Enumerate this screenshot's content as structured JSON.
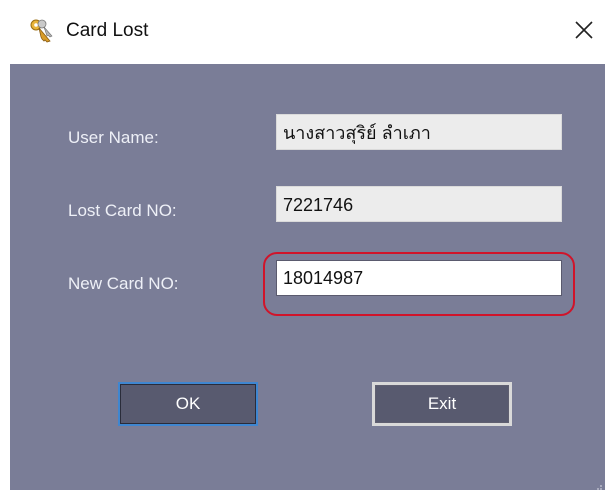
{
  "window": {
    "title": "Card Lost",
    "close_glyph": "✕",
    "icon": "keys-icon"
  },
  "form": {
    "user_name": {
      "label": "User Name:",
      "value": "นางสาวสุริย์ ลำเภา"
    },
    "lost_card": {
      "label": "Lost Card NO:",
      "value": "7221746"
    },
    "new_card": {
      "label": "New Card NO:",
      "value": "18014987"
    }
  },
  "buttons": {
    "ok_label": "OK",
    "exit_label": "Exit"
  },
  "colors": {
    "client_background": "#7a7d97",
    "highlight": "#d0142a",
    "ok_focus_border": "#3f86d0"
  }
}
